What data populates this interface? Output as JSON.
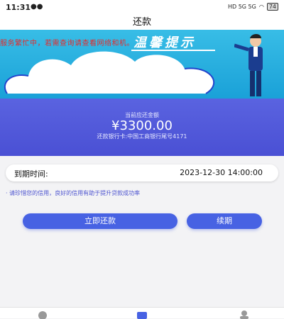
{
  "status_bar": {
    "time": "11:31",
    "battery": "74",
    "network": "HD 5G 5G"
  },
  "header": {
    "title": "还款"
  },
  "banner": {
    "scroll_text": "服务繁忙中，若需查询请查看网络和机。",
    "title": "温馨提示"
  },
  "summary": {
    "amount_label": "当前应还金额",
    "amount": "¥3300.00",
    "bank_info": "还款银行卡:中国工商银行尾号4171"
  },
  "due": {
    "label": "到期时间:",
    "value": "2023-12-30 14:00:00"
  },
  "notice": "· 请珍惜您的信用，良好的信用有助于提升贷款成功率",
  "actions": {
    "pay_label": "立即还款",
    "renew_label": "续期"
  },
  "colors": {
    "accent": "#4762e3",
    "banner": "#1aa1d8",
    "summary": "#4f56d9",
    "alert_text": "#e62a2a"
  },
  "tabbar": {
    "items": [
      {
        "icon": "home-icon"
      },
      {
        "icon": "wallet-icon"
      },
      {
        "icon": "user-icon"
      }
    ]
  }
}
